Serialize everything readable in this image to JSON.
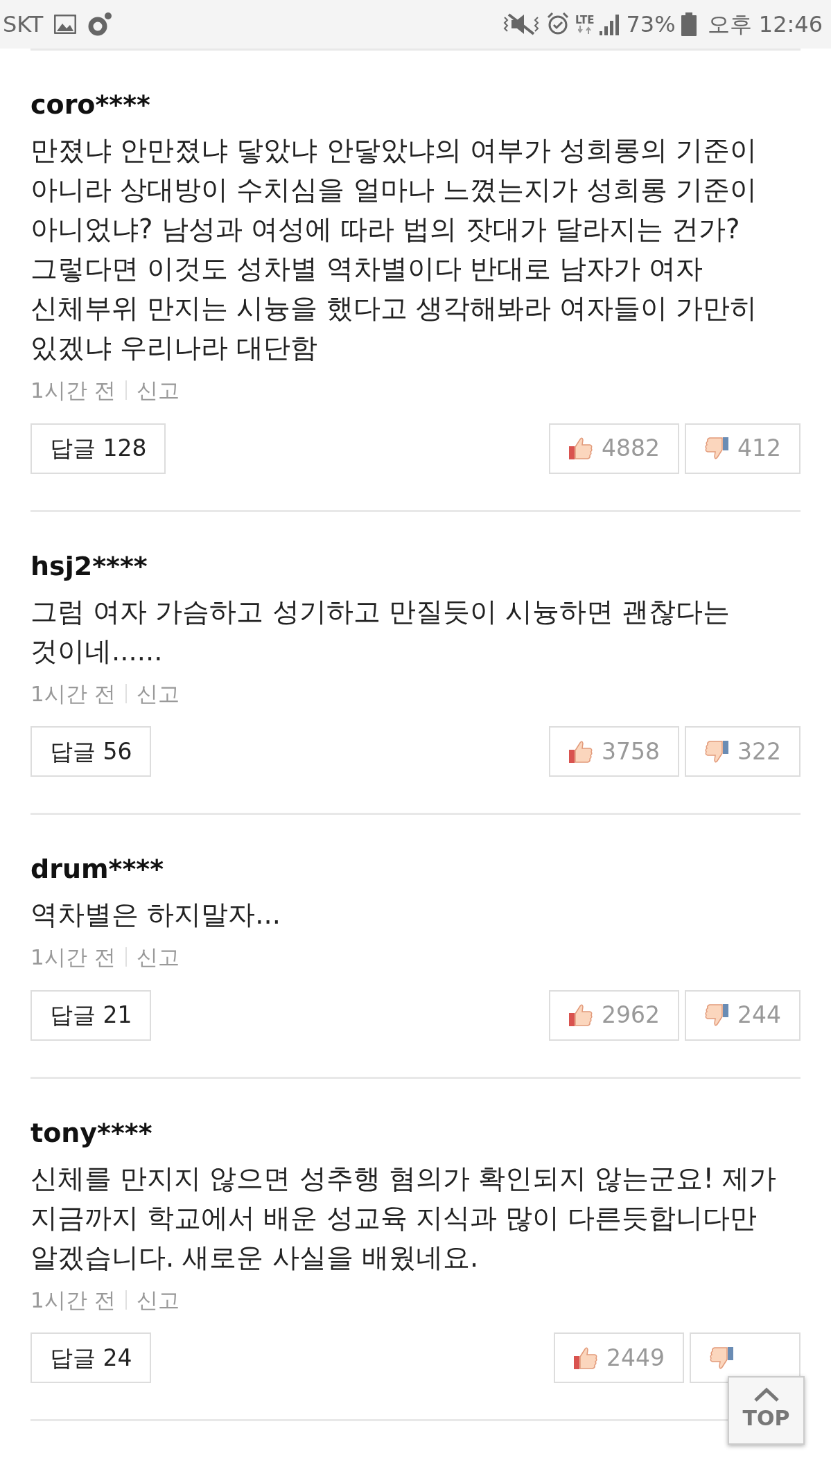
{
  "status_bar": {
    "carrier": "SKT",
    "network": "LTE",
    "battery": "73%",
    "time": "오후 12:46"
  },
  "comments": [
    {
      "user": "coro****",
      "text": "만졌냐 안만졌냐 닿았냐 안닿았냐의 여부가 성희롱의 기준이 아니라 상대방이 수치심을 얼마나 느꼈는지가 성희롱 기준이 아니었냐? 남성과 여성에 따라 법의 잣대가 달라지는 건가? 그렇다면 이것도 성차별 역차별이다 반대로 남자가 여자 신체부위 만지는 시늉을 했다고 생각해봐라 여자들이 가만히 있겠냐 우리나라 대단함",
      "time": "1시간 전",
      "report": "신고",
      "replies": "답글 128",
      "likes": "4882",
      "dislikes": "412"
    },
    {
      "user": "hsj2****",
      "text": "그럼 여자 가슴하고 성기하고 만질듯이 시늉하면 괜찮다는 것이네......",
      "time": "1시간 전",
      "report": "신고",
      "replies": "답글 56",
      "likes": "3758",
      "dislikes": "322"
    },
    {
      "user": "drum****",
      "text": "역차별은 하지말자...",
      "time": "1시간 전",
      "report": "신고",
      "replies": "답글 21",
      "likes": "2962",
      "dislikes": "244"
    },
    {
      "user": "tony****",
      "text": "신체를 만지지 않으면 성추행 혐의가 확인되지 않는군요! 제가 지금까지 학교에서 배운 성교육 지식과 많이 다른듯합니다만 알겠습니다. 새로운 사실을 배웠네요.",
      "time": "1시간 전",
      "report": "신고",
      "replies": "답글 24",
      "likes": "2449"
    }
  ],
  "top_button": {
    "label": "TOP"
  }
}
